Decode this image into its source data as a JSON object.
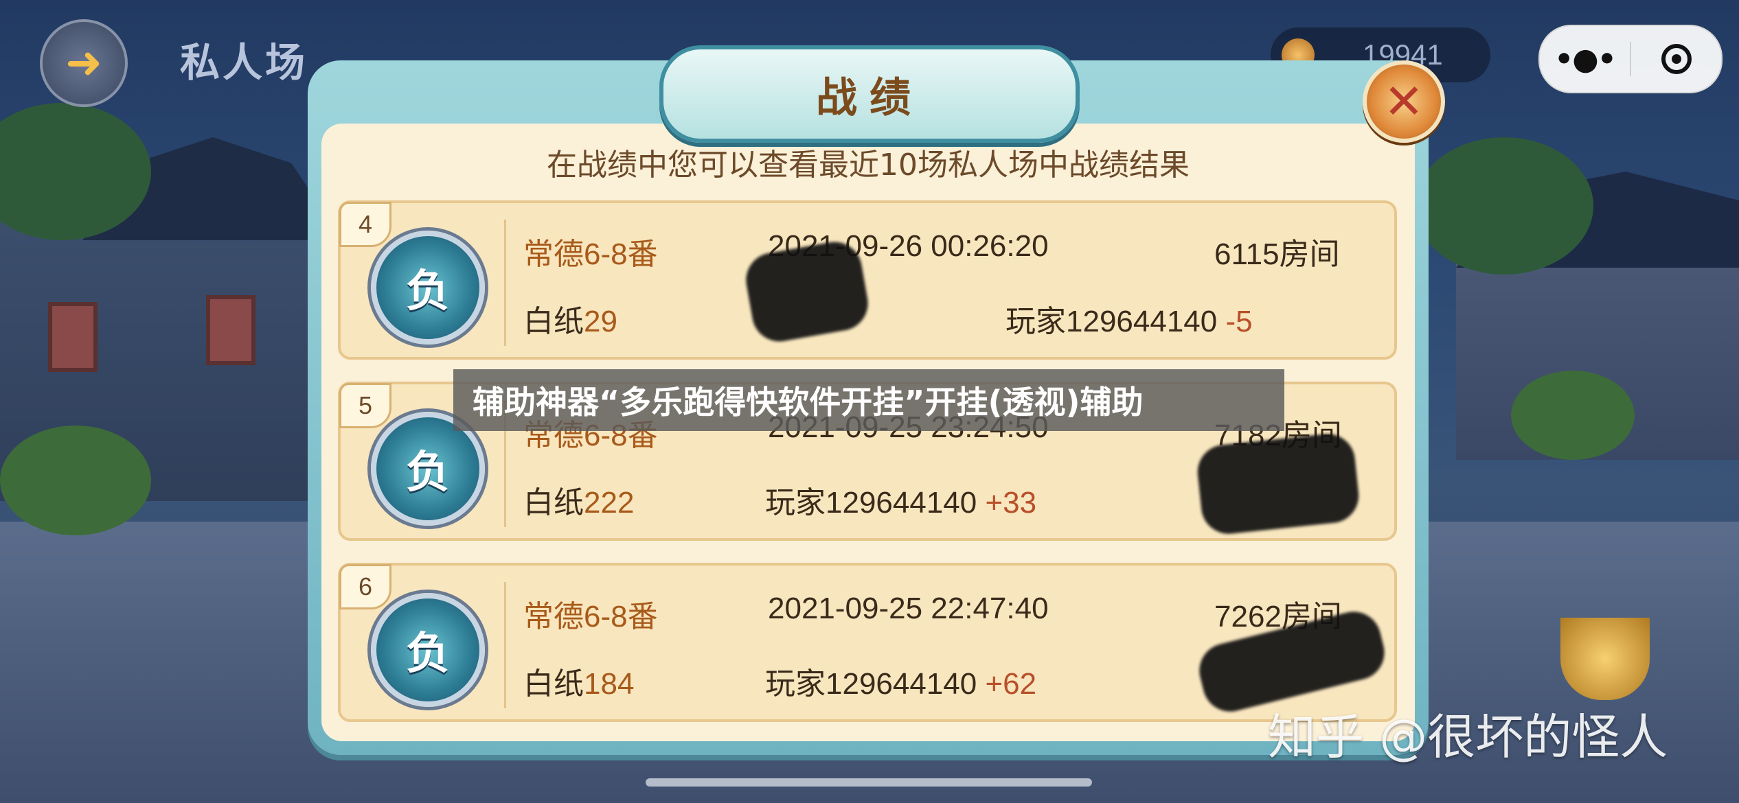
{
  "header": {
    "back_icon": "back-arrow-icon",
    "title": "私人场",
    "coins": "19941"
  },
  "capsule": {
    "more_icon": "more-dots-icon",
    "close_icon": "target-circle-icon"
  },
  "modal": {
    "title": "战绩",
    "close_label": "✕",
    "subtitle": "在战绩中您可以查看最近10场私人场中战绩结果",
    "records": [
      {
        "index": "4",
        "result": "负",
        "type": "常德6-8番",
        "time": "2021-09-26 00:26:20",
        "room": "6115房间",
        "paper_label": "白纸",
        "paper_value": "29",
        "player": "玩家129644140",
        "score": "-5"
      },
      {
        "index": "5",
        "result": "负",
        "type": "常德6-8番",
        "time": "2021-09-25 23:24:50",
        "room": "7182房间",
        "paper_label": "白纸",
        "paper_value": "222",
        "player": "玩家129644140",
        "score": "+33"
      },
      {
        "index": "6",
        "result": "负",
        "type": "常德6-8番",
        "time": "2021-09-25 22:47:40",
        "room": "7262房间",
        "paper_label": "白纸",
        "paper_value": "184",
        "player": "玩家129644140",
        "score": "+62"
      }
    ]
  },
  "overlay": {
    "banner": "辅助神器“多乐跑得快软件开挂”开挂(透视)辅助",
    "watermark": "知乎 @很坏的怪人"
  },
  "colors": {
    "accent_orange": "#a85a1a",
    "panel_bg": "#fbf0d8",
    "frame_teal": "#6fb3c2"
  }
}
